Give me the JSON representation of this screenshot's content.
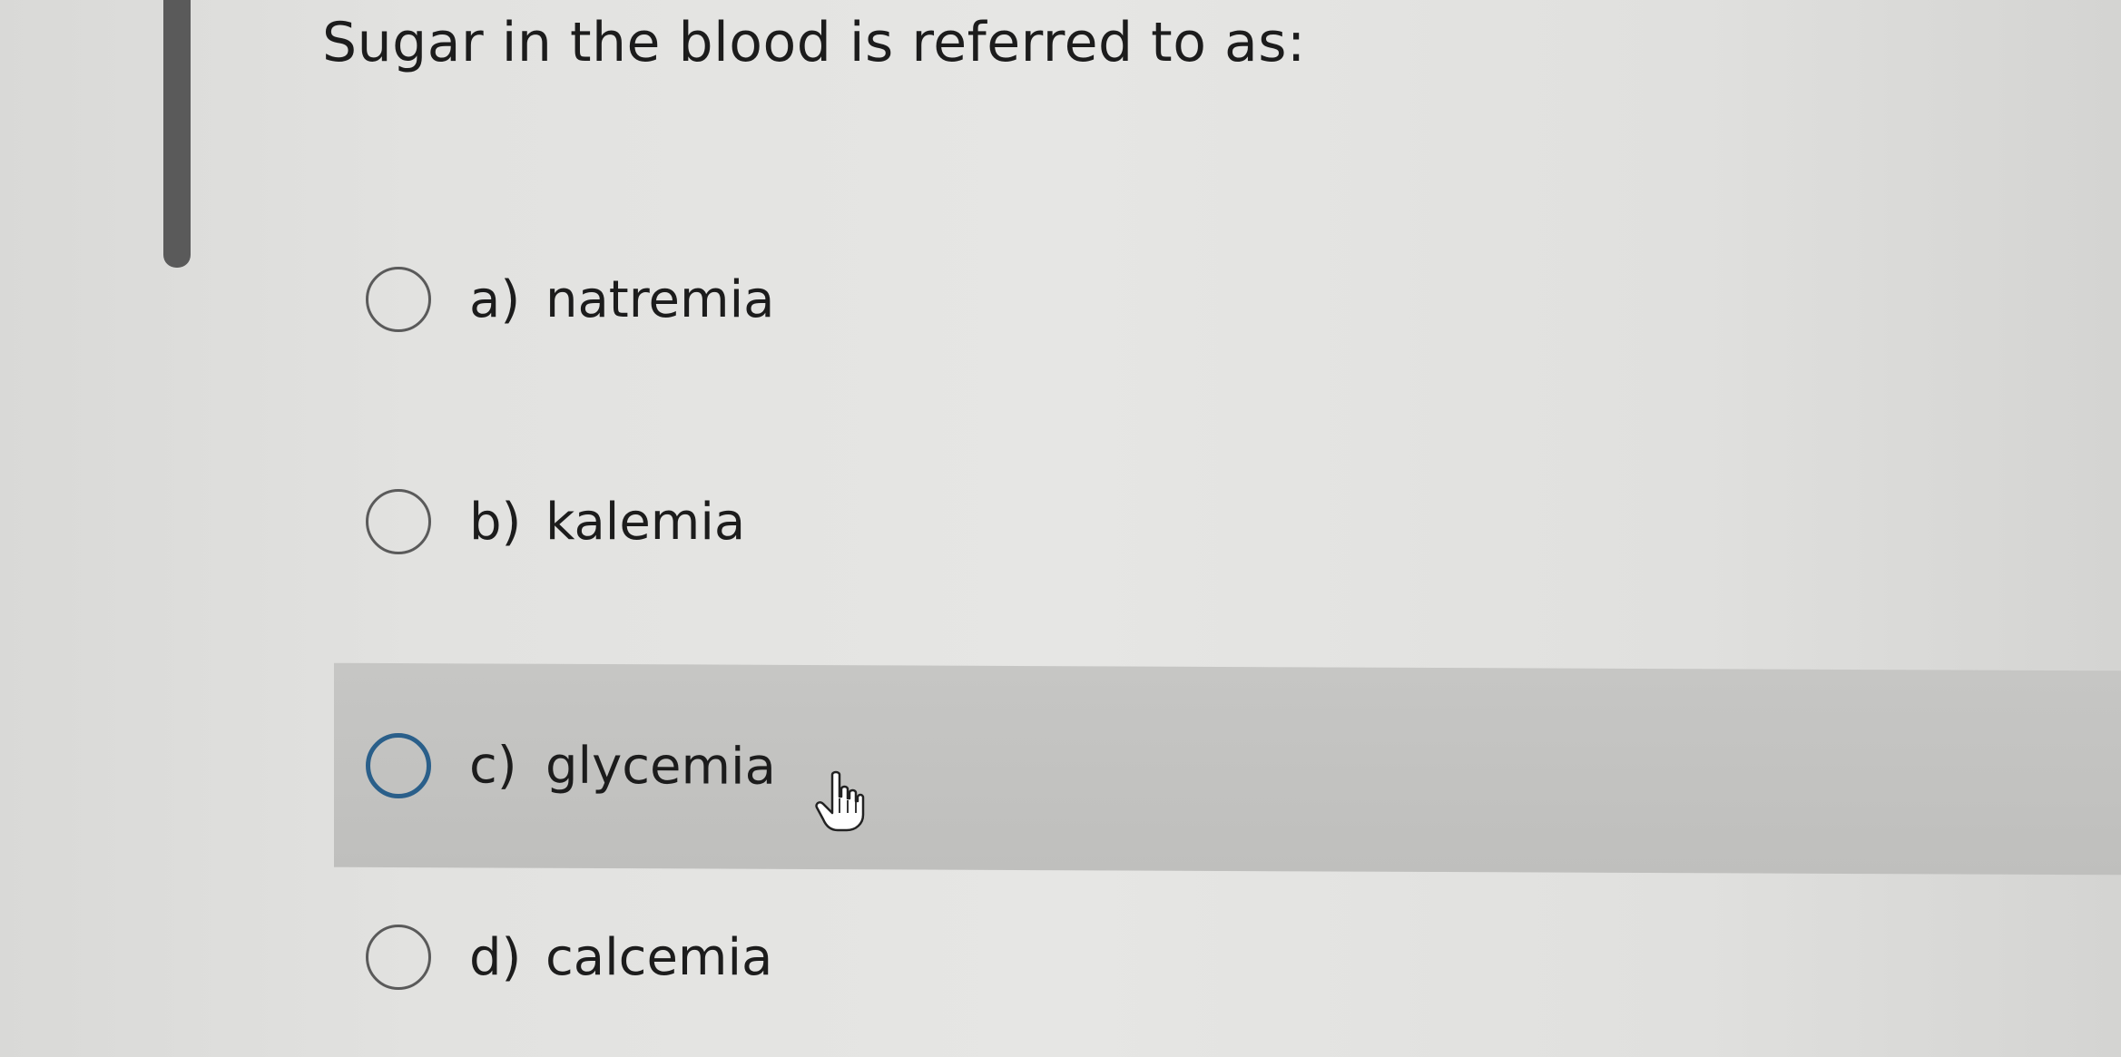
{
  "question": {
    "text": "Sugar in the blood is referred to as:"
  },
  "options": [
    {
      "letter": "a)",
      "text": "natremia",
      "highlighted": false
    },
    {
      "letter": "b)",
      "text": "kalemia",
      "highlighted": false
    },
    {
      "letter": "c)",
      "text": "glycemia",
      "highlighted": true
    },
    {
      "letter": "d)",
      "text": "calcemia",
      "highlighted": false
    }
  ],
  "icons": {
    "radio": "radio-button-icon",
    "cursor": "hand-pointer-icon"
  },
  "colors": {
    "highlight": "#c2c2c0",
    "focused_radio": "#2a5f8a",
    "scrollbar": "#5a5a5a"
  }
}
